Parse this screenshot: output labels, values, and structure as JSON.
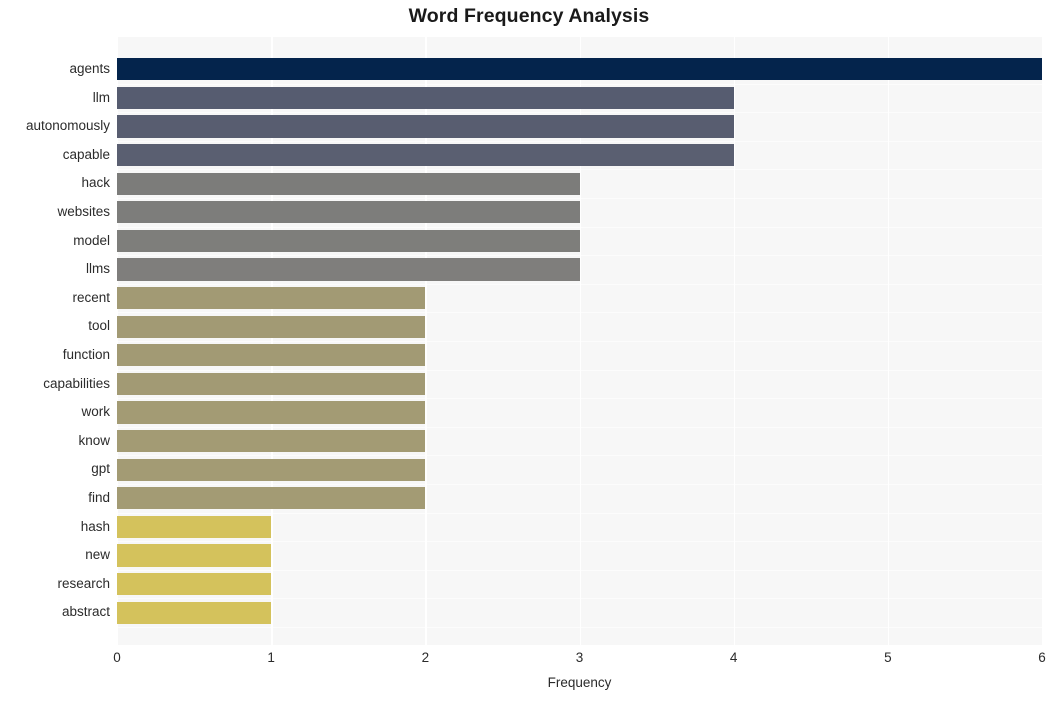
{
  "chart_data": {
    "type": "bar",
    "orientation": "horizontal",
    "title": "Word Frequency Analysis",
    "xlabel": "Frequency",
    "ylabel": "",
    "xlim": [
      0,
      6
    ],
    "xticks": [
      "0",
      "1",
      "2",
      "3",
      "4",
      "5",
      "6"
    ],
    "grid": true,
    "legend": false,
    "categories": [
      "agents",
      "llm",
      "autonomously",
      "capable",
      "hack",
      "websites",
      "model",
      "llms",
      "recent",
      "tool",
      "function",
      "capabilities",
      "work",
      "know",
      "gpt",
      "find",
      "hash",
      "new",
      "research",
      "abstract"
    ],
    "values": [
      6,
      4,
      4,
      4,
      3,
      3,
      3,
      3,
      2,
      2,
      2,
      2,
      2,
      2,
      2,
      2,
      1,
      1,
      1,
      1
    ],
    "bar_colors": [
      "#04244c",
      "#565c70",
      "#585d70",
      "#5a5f71",
      "#7c7c7a",
      "#7d7d7b",
      "#7e7e7b",
      "#7f7e7c",
      "#a29a74",
      "#a29a74",
      "#a29a74",
      "#a29a74",
      "#a39b74",
      "#a39b74",
      "#a39b74",
      "#a39b74",
      "#d4c25c",
      "#d4c25c",
      "#d4c25c",
      "#d4c25c"
    ],
    "plot_background": "#f7f7f7",
    "gridline_color": "#ffffff",
    "figure_background": "#ffffff",
    "text_color": "#2b2b2b"
  }
}
